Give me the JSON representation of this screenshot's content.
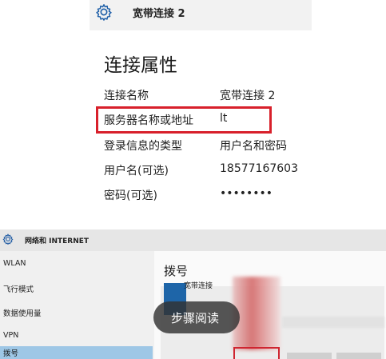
{
  "header": {
    "title": "宽带连接 2"
  },
  "connection_properties": {
    "title": "连接属性",
    "rows": [
      {
        "label": "连接名称",
        "value": "宽带连接 2"
      },
      {
        "label": "服务器名称或地址",
        "value": "lt"
      },
      {
        "label": "登录信息的类型",
        "value": "用户名和密码"
      },
      {
        "label": "用户名(可选)",
        "value": "18577167603"
      },
      {
        "label": "密码(可选)",
        "value": "••••••••"
      }
    ]
  },
  "settings_window": {
    "title": "网络和 INTERNET",
    "nav": [
      {
        "label": "WLAN"
      },
      {
        "label": "飞行模式"
      },
      {
        "label": "数据使用量"
      },
      {
        "label": "VPN"
      },
      {
        "label": "拨号"
      }
    ],
    "content_title": "拨号",
    "connection_item": "宽带连接"
  },
  "overlay": {
    "label": "步骤阅读"
  },
  "colors": {
    "highlight_red": "#d8202b",
    "selected_nav": "#9ec7e6",
    "icon_blue": "#1e65a8"
  }
}
